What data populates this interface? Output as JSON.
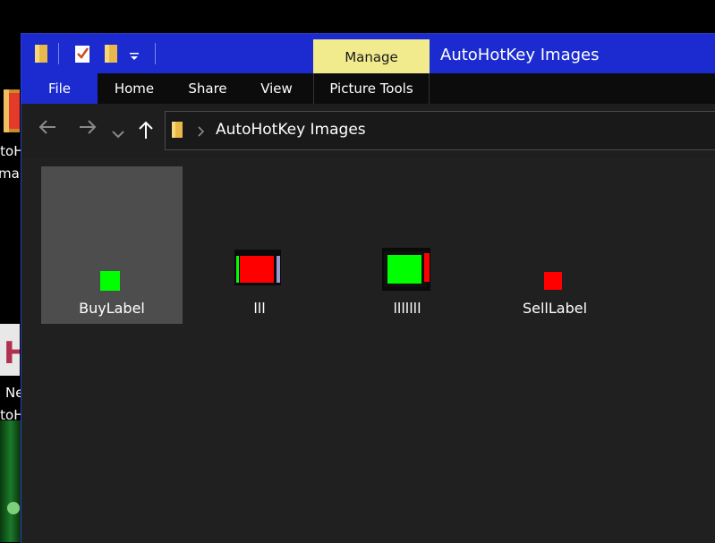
{
  "desktop": {
    "label_fragments": [
      "itoH",
      "ma",
      "Ne",
      "itoH"
    ]
  },
  "window": {
    "title": "AutoHotKey Images",
    "manage_tab_label": "Manage",
    "ribbon_tabs": [
      "File",
      "Home",
      "Share",
      "View",
      "Picture Tools"
    ]
  },
  "address_bar": {
    "path": "AutoHotKey Images"
  },
  "files": [
    {
      "name": "BuyLabel",
      "selected": true
    },
    {
      "name": "lll",
      "selected": false
    },
    {
      "name": "lllllll",
      "selected": false
    },
    {
      "name": "SellLabel",
      "selected": false
    }
  ],
  "colors": {
    "title_bar": "#1b2bd0",
    "manage_tab": "#f1eb8e",
    "thumb_green": "#00ff00",
    "thumb_red": "#ff0000"
  }
}
